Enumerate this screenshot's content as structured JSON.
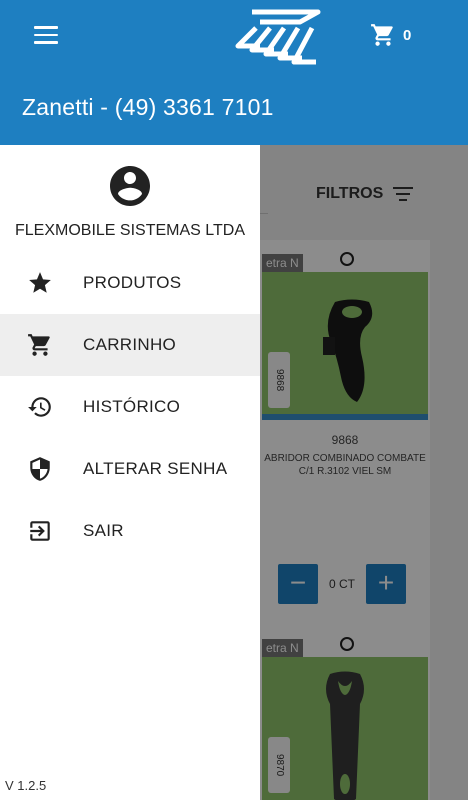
{
  "header": {
    "title": "Zanetti - (49) 3361 7101",
    "cart_count": "0",
    "brand_color": "#1e7fc1"
  },
  "background": {
    "filters_label": "FILTROS",
    "products": [
      {
        "tag": "etra N",
        "side_code": "9868",
        "code": "9868",
        "description": "ABRIDOR COMBINADO COMBATE C/1 R.3102 VIEL SM",
        "quantity": "0 CT"
      },
      {
        "tag": "etra N",
        "side_code": "9870"
      }
    ],
    "minus_label": "−",
    "plus_label": "+"
  },
  "drawer": {
    "company": "FLEXMOBILE SISTEMAS LTDA",
    "items": [
      {
        "label": "PRODUTOS",
        "icon": "star-icon"
      },
      {
        "label": "CARRINHO",
        "icon": "cart-icon"
      },
      {
        "label": "HISTÓRICO",
        "icon": "history-icon"
      },
      {
        "label": "ALTERAR SENHA",
        "icon": "shield-icon"
      },
      {
        "label": "SAIR",
        "icon": "logout-icon"
      }
    ],
    "active_item": "CARRINHO",
    "version": "V 1.2.5"
  }
}
